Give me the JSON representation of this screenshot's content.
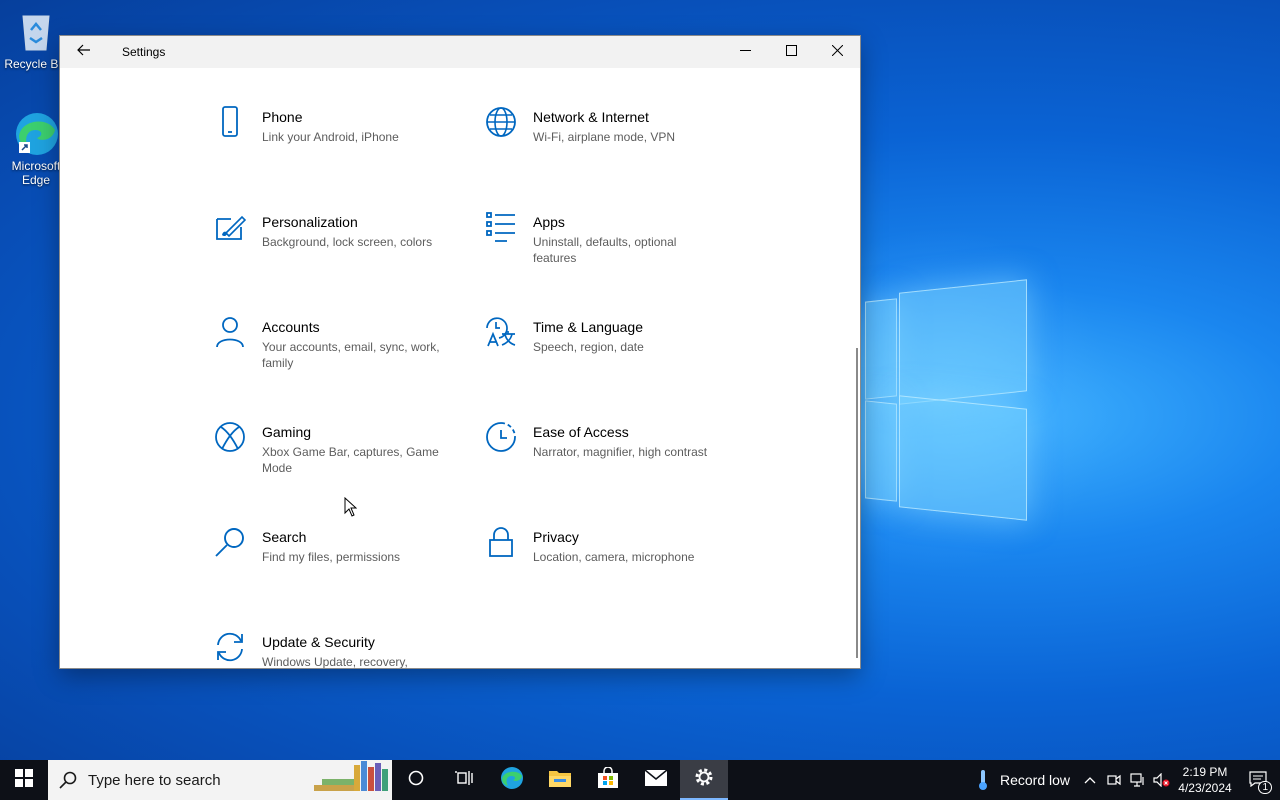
{
  "desktop": {
    "icons": [
      {
        "label": "Recycle Bin"
      },
      {
        "label": "Microsoft Edge"
      }
    ]
  },
  "window": {
    "title": "Settings",
    "back_icon": "arrow-left-icon",
    "controls": [
      "minimize-icon",
      "maximize-icon",
      "close-icon"
    ]
  },
  "settings": {
    "tiles": [
      {
        "name": "Phone",
        "desc": "Link your Android, iPhone",
        "icon": "phone-icon"
      },
      {
        "name": "Network & Internet",
        "desc": "Wi-Fi, airplane mode, VPN",
        "icon": "globe-icon"
      },
      {
        "name": "Personalization",
        "desc": "Background, lock screen, colors",
        "icon": "paint-icon"
      },
      {
        "name": "Apps",
        "desc": "Uninstall, defaults, optional features",
        "icon": "apps-list-icon"
      },
      {
        "name": "Accounts",
        "desc": "Your accounts, email, sync, work, family",
        "icon": "person-icon"
      },
      {
        "name": "Time & Language",
        "desc": "Speech, region, date",
        "icon": "time-language-icon"
      },
      {
        "name": "Gaming",
        "desc": "Xbox Game Bar, captures, Game Mode",
        "icon": "xbox-icon"
      },
      {
        "name": "Ease of Access",
        "desc": "Narrator, magnifier, high contrast",
        "icon": "ease-of-access-icon"
      },
      {
        "name": "Search",
        "desc": "Find my files, permissions",
        "icon": "search-icon"
      },
      {
        "name": "Privacy",
        "desc": "Location, camera, microphone",
        "icon": "lock-icon"
      },
      {
        "name": "Update & Security",
        "desc": "Windows Update, recovery,",
        "icon": "sync-icon"
      }
    ]
  },
  "taskbar": {
    "search_placeholder": "Type here to search",
    "weather": "Record low",
    "time": "2:19 PM",
    "date": "4/23/2024",
    "notification_count": "1"
  },
  "colors": {
    "accent": "#0067c0",
    "taskbar": "#0d1017"
  }
}
